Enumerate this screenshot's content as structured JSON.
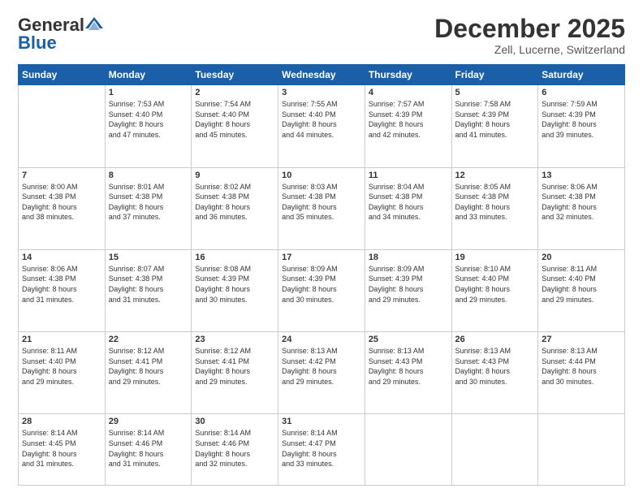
{
  "header": {
    "logo_general": "General",
    "logo_blue": "Blue",
    "month": "December 2025",
    "location": "Zell, Lucerne, Switzerland"
  },
  "weekdays": [
    "Sunday",
    "Monday",
    "Tuesday",
    "Wednesday",
    "Thursday",
    "Friday",
    "Saturday"
  ],
  "weeks": [
    [
      {
        "num": "",
        "info": ""
      },
      {
        "num": "1",
        "info": "Sunrise: 7:53 AM\nSunset: 4:40 PM\nDaylight: 8 hours\nand 47 minutes."
      },
      {
        "num": "2",
        "info": "Sunrise: 7:54 AM\nSunset: 4:40 PM\nDaylight: 8 hours\nand 45 minutes."
      },
      {
        "num": "3",
        "info": "Sunrise: 7:55 AM\nSunset: 4:40 PM\nDaylight: 8 hours\nand 44 minutes."
      },
      {
        "num": "4",
        "info": "Sunrise: 7:57 AM\nSunset: 4:39 PM\nDaylight: 8 hours\nand 42 minutes."
      },
      {
        "num": "5",
        "info": "Sunrise: 7:58 AM\nSunset: 4:39 PM\nDaylight: 8 hours\nand 41 minutes."
      },
      {
        "num": "6",
        "info": "Sunrise: 7:59 AM\nSunset: 4:39 PM\nDaylight: 8 hours\nand 39 minutes."
      }
    ],
    [
      {
        "num": "7",
        "info": "Sunrise: 8:00 AM\nSunset: 4:38 PM\nDaylight: 8 hours\nand 38 minutes."
      },
      {
        "num": "8",
        "info": "Sunrise: 8:01 AM\nSunset: 4:38 PM\nDaylight: 8 hours\nand 37 minutes."
      },
      {
        "num": "9",
        "info": "Sunrise: 8:02 AM\nSunset: 4:38 PM\nDaylight: 8 hours\nand 36 minutes."
      },
      {
        "num": "10",
        "info": "Sunrise: 8:03 AM\nSunset: 4:38 PM\nDaylight: 8 hours\nand 35 minutes."
      },
      {
        "num": "11",
        "info": "Sunrise: 8:04 AM\nSunset: 4:38 PM\nDaylight: 8 hours\nand 34 minutes."
      },
      {
        "num": "12",
        "info": "Sunrise: 8:05 AM\nSunset: 4:38 PM\nDaylight: 8 hours\nand 33 minutes."
      },
      {
        "num": "13",
        "info": "Sunrise: 8:06 AM\nSunset: 4:38 PM\nDaylight: 8 hours\nand 32 minutes."
      }
    ],
    [
      {
        "num": "14",
        "info": "Sunrise: 8:06 AM\nSunset: 4:38 PM\nDaylight: 8 hours\nand 31 minutes."
      },
      {
        "num": "15",
        "info": "Sunrise: 8:07 AM\nSunset: 4:38 PM\nDaylight: 8 hours\nand 31 minutes."
      },
      {
        "num": "16",
        "info": "Sunrise: 8:08 AM\nSunset: 4:39 PM\nDaylight: 8 hours\nand 30 minutes."
      },
      {
        "num": "17",
        "info": "Sunrise: 8:09 AM\nSunset: 4:39 PM\nDaylight: 8 hours\nand 30 minutes."
      },
      {
        "num": "18",
        "info": "Sunrise: 8:09 AM\nSunset: 4:39 PM\nDaylight: 8 hours\nand 29 minutes."
      },
      {
        "num": "19",
        "info": "Sunrise: 8:10 AM\nSunset: 4:40 PM\nDaylight: 8 hours\nand 29 minutes."
      },
      {
        "num": "20",
        "info": "Sunrise: 8:11 AM\nSunset: 4:40 PM\nDaylight: 8 hours\nand 29 minutes."
      }
    ],
    [
      {
        "num": "21",
        "info": "Sunrise: 8:11 AM\nSunset: 4:40 PM\nDaylight: 8 hours\nand 29 minutes."
      },
      {
        "num": "22",
        "info": "Sunrise: 8:12 AM\nSunset: 4:41 PM\nDaylight: 8 hours\nand 29 minutes."
      },
      {
        "num": "23",
        "info": "Sunrise: 8:12 AM\nSunset: 4:41 PM\nDaylight: 8 hours\nand 29 minutes."
      },
      {
        "num": "24",
        "info": "Sunrise: 8:13 AM\nSunset: 4:42 PM\nDaylight: 8 hours\nand 29 minutes."
      },
      {
        "num": "25",
        "info": "Sunrise: 8:13 AM\nSunset: 4:43 PM\nDaylight: 8 hours\nand 29 minutes."
      },
      {
        "num": "26",
        "info": "Sunrise: 8:13 AM\nSunset: 4:43 PM\nDaylight: 8 hours\nand 30 minutes."
      },
      {
        "num": "27",
        "info": "Sunrise: 8:13 AM\nSunset: 4:44 PM\nDaylight: 8 hours\nand 30 minutes."
      }
    ],
    [
      {
        "num": "28",
        "info": "Sunrise: 8:14 AM\nSunset: 4:45 PM\nDaylight: 8 hours\nand 31 minutes."
      },
      {
        "num": "29",
        "info": "Sunrise: 8:14 AM\nSunset: 4:46 PM\nDaylight: 8 hours\nand 31 minutes."
      },
      {
        "num": "30",
        "info": "Sunrise: 8:14 AM\nSunset: 4:46 PM\nDaylight: 8 hours\nand 32 minutes."
      },
      {
        "num": "31",
        "info": "Sunrise: 8:14 AM\nSunset: 4:47 PM\nDaylight: 8 hours\nand 33 minutes."
      },
      {
        "num": "",
        "info": ""
      },
      {
        "num": "",
        "info": ""
      },
      {
        "num": "",
        "info": ""
      }
    ]
  ]
}
